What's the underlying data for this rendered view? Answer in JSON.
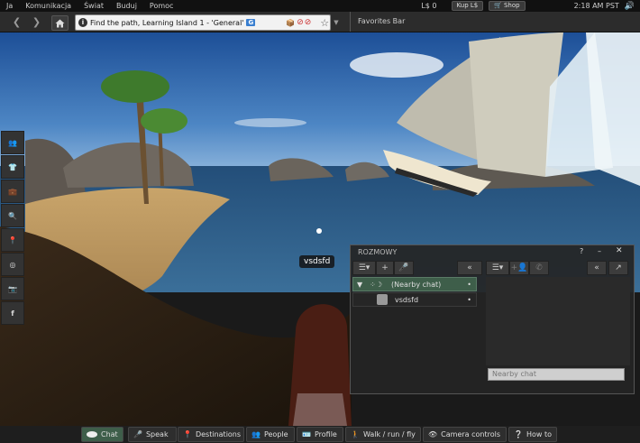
{
  "menu": [
    "Ja",
    "Komunikacja",
    "Świat",
    "Buduj",
    "Pomoc"
  ],
  "status": {
    "balance": "L$ 0",
    "buy_label": "Kup L$",
    "shop_label": "Shop",
    "time": "2:18 AM PST"
  },
  "nav": {
    "location": "Find the path, Learning Island 1 - 'General'",
    "maturity_badge": "G",
    "favorites_label": "Favorites Bar"
  },
  "avatar_name": "vsdsfd",
  "chat_panel": {
    "title": "ROZMOWY",
    "help": "?",
    "minimize": "–",
    "conversations": [
      {
        "label": "(Nearby chat)",
        "active": true
      },
      {
        "label": "vsdsfd",
        "active": false
      }
    ],
    "input_placeholder": "Nearby chat"
  },
  "bottom_buttons": [
    {
      "label": "Chat",
      "icon": "chat-bubble-icon",
      "active": true
    },
    {
      "label": "Speak",
      "icon": "microphone-icon",
      "active": false
    },
    {
      "label": "Destinations",
      "icon": "map-pin-icon",
      "active": false
    },
    {
      "label": "People",
      "icon": "people-icon",
      "active": false
    },
    {
      "label": "Profile",
      "icon": "profile-icon",
      "active": false
    },
    {
      "label": "Walk / run / fly",
      "icon": "walk-icon",
      "active": false
    },
    {
      "label": "Camera controls",
      "icon": "eye-icon",
      "active": false
    },
    {
      "label": "How to",
      "icon": "help-icon",
      "active": false
    }
  ],
  "left_tools": [
    "appearance-icon",
    "shirt-icon",
    "inventory-icon",
    "search-icon",
    "places-icon",
    "radar-icon",
    "snapshot-icon",
    "facebook-icon"
  ]
}
